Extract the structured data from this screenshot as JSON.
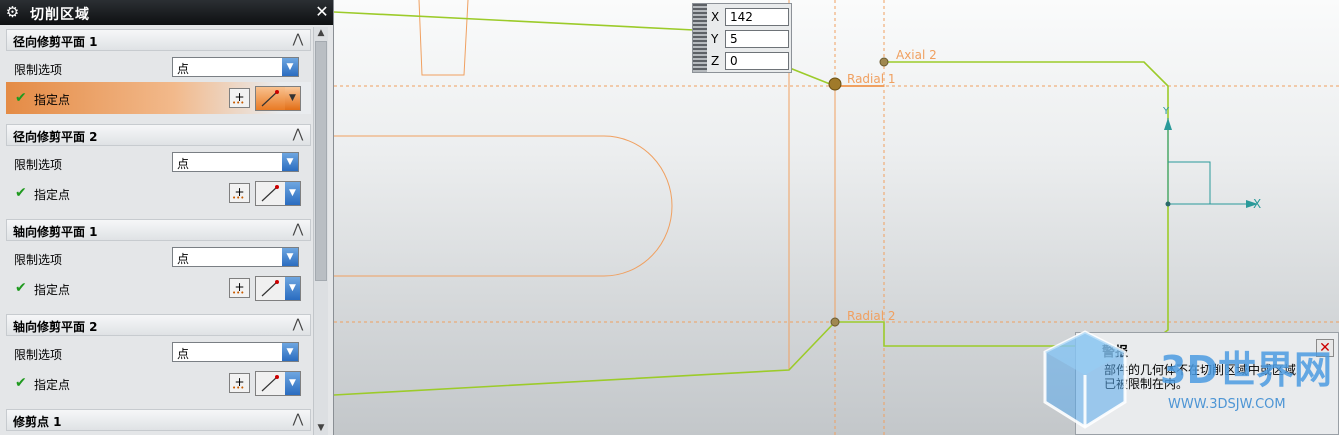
{
  "dialog": {
    "title": "切削区域",
    "sections": [
      {
        "header": "径向修剪平面 1",
        "limit_label": "限制选项",
        "limit_value": "点",
        "point_label": "指定点",
        "active": true
      },
      {
        "header": "径向修剪平面 2",
        "limit_label": "限制选项",
        "limit_value": "点",
        "point_label": "指定点",
        "active": false
      },
      {
        "header": "轴向修剪平面 1",
        "limit_label": "限制选项",
        "limit_value": "点",
        "point_label": "指定点",
        "active": false
      },
      {
        "header": "轴向修剪平面 2",
        "limit_label": "限制选项",
        "limit_value": "点",
        "point_label": "指定点",
        "active": false
      },
      {
        "header": "修剪点 1"
      }
    ]
  },
  "coordinates": {
    "x_label": "X",
    "x_value": "142",
    "y_label": "Y",
    "y_value": "5",
    "z_label": "Z",
    "z_value": "0"
  },
  "viewport": {
    "labels": {
      "radial1": "Radial 1",
      "radial2": "Radial 2",
      "axial2": "Axial 2"
    },
    "axis_x": "X",
    "axis_y": "Y"
  },
  "warning": {
    "title": "警报",
    "message": "部件的几何体不在切削区域中或区域已被限制在内。"
  },
  "watermark": {
    "brand": "3D世界网",
    "url": "WWW.3DSJW.COM"
  }
}
